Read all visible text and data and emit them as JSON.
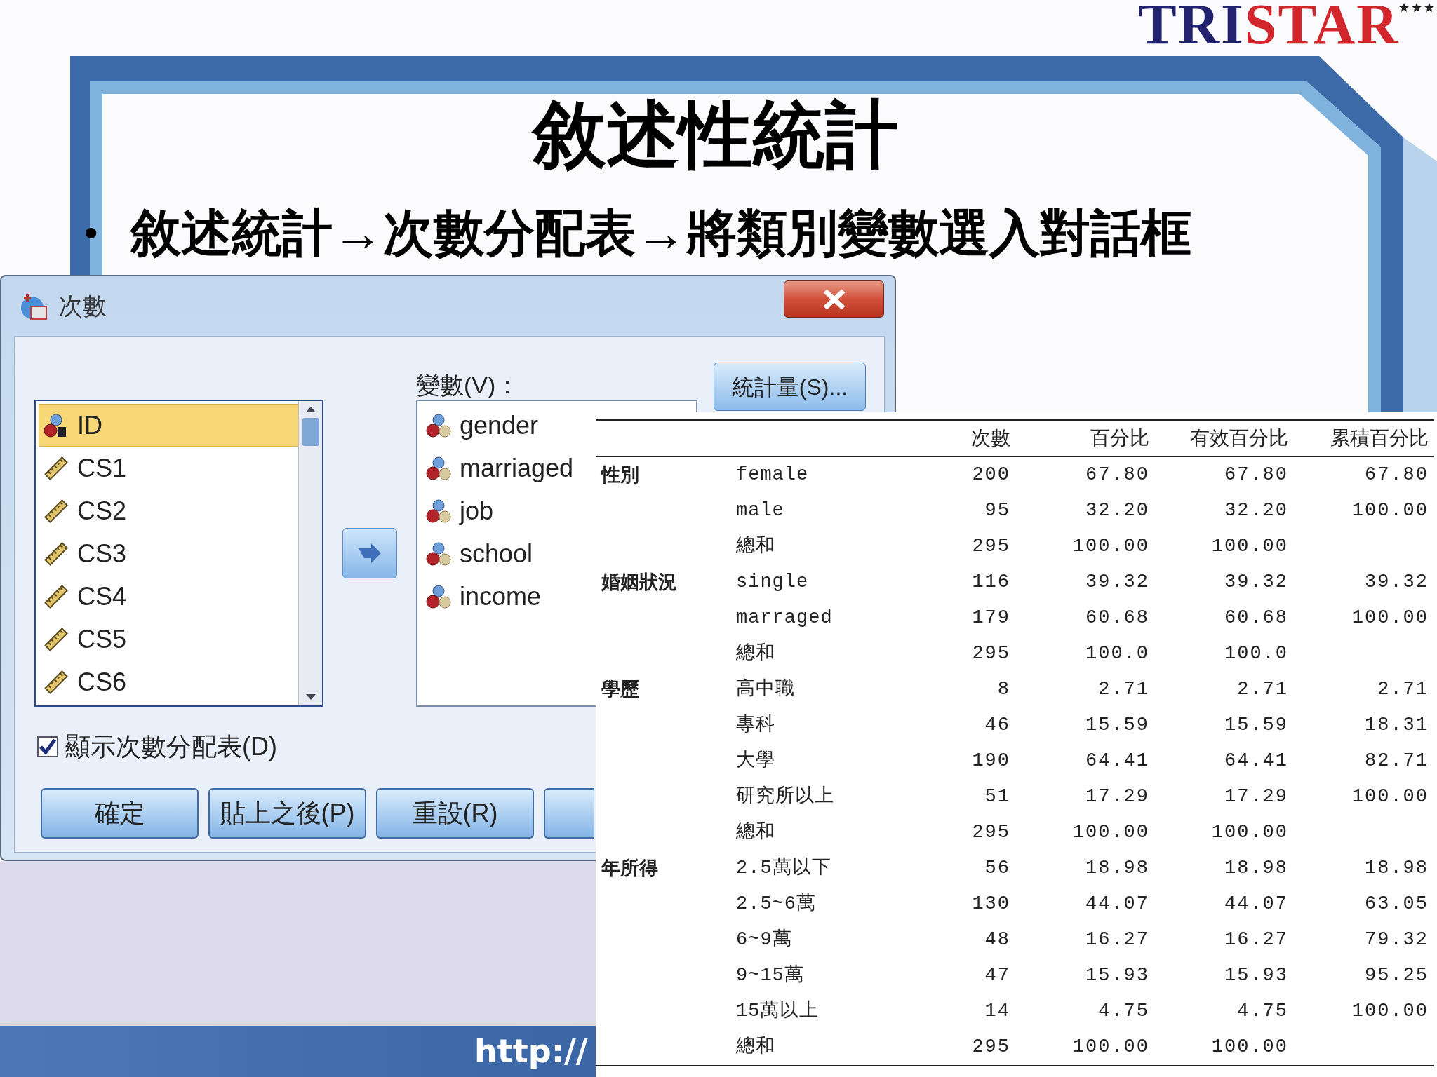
{
  "logo": {
    "parts": [
      {
        "text": "TRI",
        "color": "#23226e"
      },
      {
        "text": "STAR",
        "color": "#d3262c"
      }
    ]
  },
  "slide": {
    "title": "敘述性統計",
    "bullet": "•",
    "bullet_text": "敘述統計→次數分配表→將類別變數選入對話框",
    "footer_link": "http://"
  },
  "dialog": {
    "title": "次數",
    "source_list": [
      {
        "label": "ID",
        "kind": "string",
        "selected": true
      },
      {
        "label": "CS1",
        "kind": "scale",
        "selected": false
      },
      {
        "label": "CS2",
        "kind": "scale",
        "selected": false
      },
      {
        "label": "CS3",
        "kind": "scale",
        "selected": false
      },
      {
        "label": "CS4",
        "kind": "scale",
        "selected": false
      },
      {
        "label": "CS5",
        "kind": "scale",
        "selected": false
      },
      {
        "label": "CS6",
        "kind": "scale",
        "selected": false
      }
    ],
    "variables_label": "變數(V)：",
    "variables": [
      {
        "label": "gender",
        "kind": "nominal"
      },
      {
        "label": "marriaged",
        "kind": "nominal"
      },
      {
        "label": "job",
        "kind": "nominal"
      },
      {
        "label": "school",
        "kind": "nominal"
      },
      {
        "label": "income",
        "kind": "nominal"
      }
    ],
    "statistics_button": "統計量(S)...",
    "show_tables": {
      "label": "顯示次數分配表(D)",
      "checked": true
    },
    "buttons": [
      "確定",
      "貼上之後(P)",
      "重設(R)"
    ]
  },
  "table": {
    "columns": [
      "次數",
      "百分比",
      "有效百分比",
      "累積百分比"
    ],
    "groups": [
      {
        "label": "性別",
        "rows": [
          {
            "value": "female",
            "count": "200",
            "percent": "67.80",
            "valid_percent": "67.80",
            "cumulative": "67.80"
          },
          {
            "value": "male",
            "count": "95",
            "percent": "32.20",
            "valid_percent": "32.20",
            "cumulative": "100.00"
          },
          {
            "value": "總和",
            "count": "295",
            "percent": "100.00",
            "valid_percent": "100.00"
          }
        ]
      },
      {
        "label": "婚姻狀況",
        "rows": [
          {
            "value": "single",
            "count": "116",
            "percent": "39.32",
            "valid_percent": "39.32",
            "cumulative": "39.32"
          },
          {
            "value": "marraged",
            "count": "179",
            "percent": "60.68",
            "valid_percent": "60.68",
            "cumulative": "100.00"
          },
          {
            "value": "總和",
            "count": "295",
            "percent": "100.0",
            "valid_percent": "100.0"
          }
        ]
      },
      {
        "label": "學歷",
        "rows": [
          {
            "value": "高中職",
            "count": "8",
            "percent": "2.71",
            "valid_percent": "2.71",
            "cumulative": "2.71"
          },
          {
            "value": "專科",
            "count": "46",
            "percent": "15.59",
            "valid_percent": "15.59",
            "cumulative": "18.31"
          },
          {
            "value": "大學",
            "count": "190",
            "percent": "64.41",
            "valid_percent": "64.41",
            "cumulative": "82.71"
          },
          {
            "value": "研究所以上",
            "count": "51",
            "percent": "17.29",
            "valid_percent": "17.29",
            "cumulative": "100.00"
          },
          {
            "value": "總和",
            "count": "295",
            "percent": "100.00",
            "valid_percent": "100.00"
          }
        ]
      },
      {
        "label": "年所得",
        "rows": [
          {
            "value": "2.5萬以下",
            "count": "56",
            "percent": "18.98",
            "valid_percent": "18.98",
            "cumulative": "18.98"
          },
          {
            "value": "2.5~6萬",
            "count": "130",
            "percent": "44.07",
            "valid_percent": "44.07",
            "cumulative": "63.05"
          },
          {
            "value": "6~9萬",
            "count": "48",
            "percent": "16.27",
            "valid_percent": "16.27",
            "cumulative": "79.32"
          },
          {
            "value": "9~15萬",
            "count": "47",
            "percent": "15.93",
            "valid_percent": "15.93",
            "cumulative": "95.25"
          },
          {
            "value": "15萬以上",
            "count": "14",
            "percent": "4.75",
            "valid_percent": "4.75",
            "cumulative": "100.00"
          },
          {
            "value": "總和",
            "count": "295",
            "percent": "100.00",
            "valid_percent": "100.00"
          }
        ]
      }
    ]
  }
}
